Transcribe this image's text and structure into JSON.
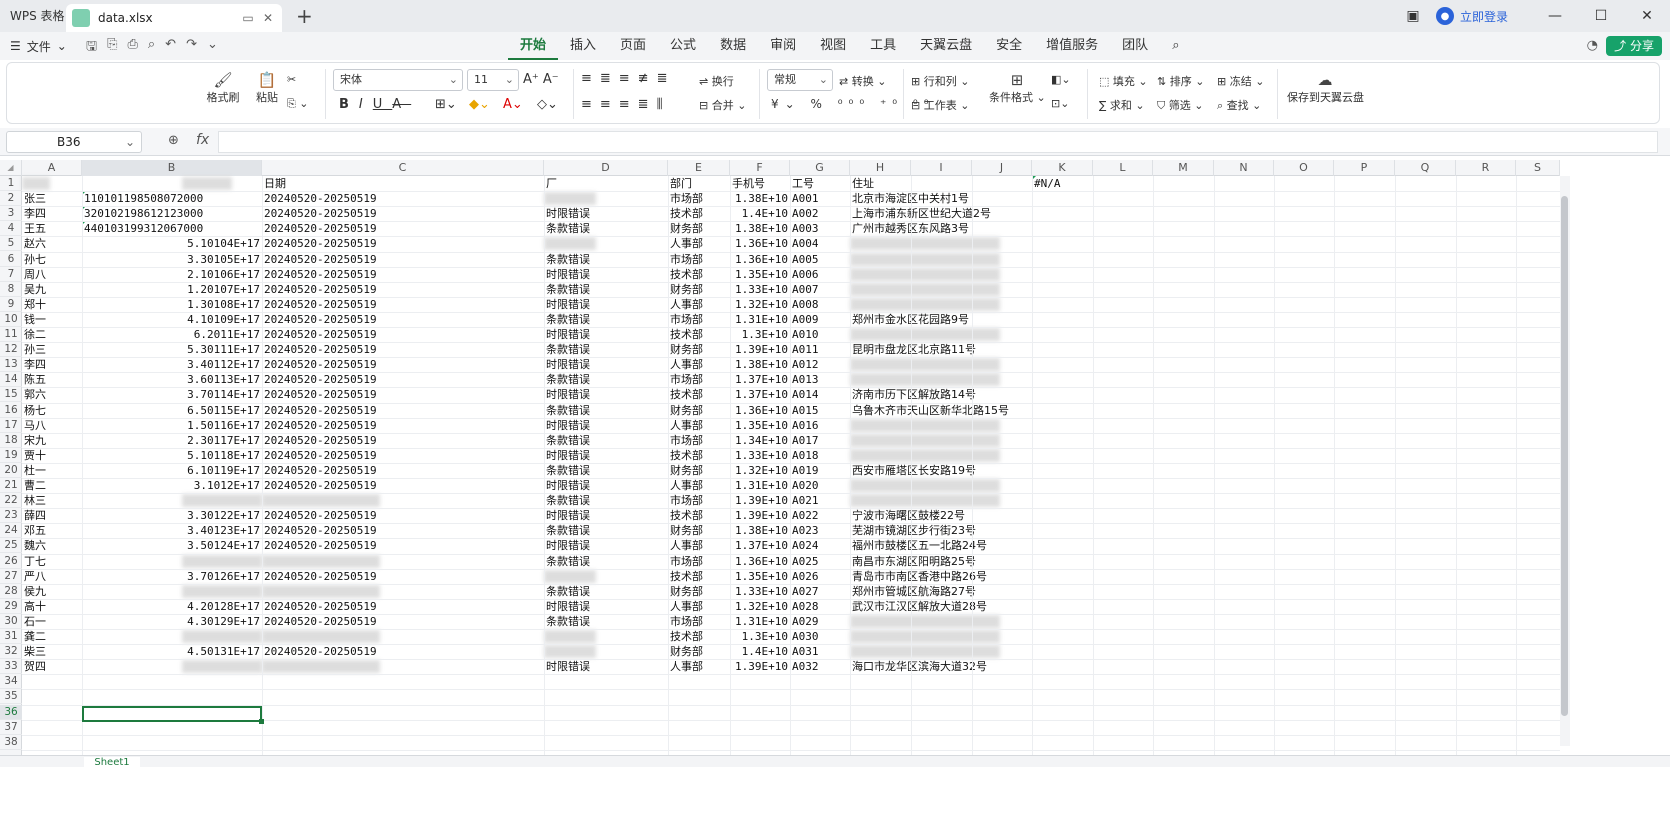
{
  "titlebar": {
    "app_tab": "WPS 表格",
    "file_tab": "data.xlsx",
    "login": "立即登录"
  },
  "menubar": {
    "file": "文件",
    "tabs": [
      "开始",
      "插入",
      "页面",
      "公式",
      "数据",
      "审阅",
      "视图",
      "工具",
      "天翼云盘",
      "安全",
      "增值服务",
      "团队"
    ],
    "share": "分享"
  },
  "ribbon": {
    "format_painter": "格式刷",
    "paste": "粘贴",
    "font_name": "宋体",
    "font_size": "11",
    "wrap": "换行",
    "merge": "合并",
    "number_format": "常规",
    "convert": "转换",
    "rows_cols": "行和列",
    "worksheet": "工作表",
    "cond_format": "条件格式",
    "fill": "填充",
    "sort": "排序",
    "freeze": "冻结",
    "sum": "求和",
    "filter": "筛选",
    "find": "查找",
    "save_cloud": "保存到天翼云盘"
  },
  "formula": {
    "cell_ref": "B36",
    "fx": "fx",
    "value": ""
  },
  "columns": [
    "A",
    "B",
    "C",
    "D",
    "E",
    "F",
    "G",
    "H",
    "I",
    "J",
    "K",
    "L",
    "M",
    "N",
    "O",
    "P",
    "Q",
    "R",
    "S"
  ],
  "rows_count": 38,
  "headers": {
    "C": "日期",
    "D": "厂",
    "E": "部门",
    "F": "手机号",
    "G": "工号",
    "H": "住址",
    "K": "#N/A"
  },
  "records": [
    {
      "a": "张三",
      "b": "110101198508072000",
      "c": "20240520-20250519",
      "d": "",
      "e": "市场部",
      "f": "1.38E+10",
      "g": "A001",
      "h": "北京市海淀区中关村1号"
    },
    {
      "a": "李四",
      "b": "320102198612123000",
      "c": "20240520-20250519",
      "d": "时限错误",
      "e": "技术部",
      "f": "1.4E+10",
      "g": "A002",
      "h": "上海市浦东新区世纪大道2号"
    },
    {
      "a": "王五",
      "b": "440103199312067000",
      "c": "20240520-20250519",
      "d": "条款错误",
      "e": "财务部",
      "f": "1.38E+10",
      "g": "A003",
      "h": "广州市越秀区东风路3号"
    },
    {
      "a": "赵六",
      "b": "5.10104E+17",
      "c": "20240520-20250519",
      "d": "",
      "e": "人事部",
      "f": "1.36E+10",
      "g": "A004",
      "h": ""
    },
    {
      "a": "孙七",
      "b": "3.30105E+17",
      "c": "20240520-20250519",
      "d": "条款错误",
      "e": "市场部",
      "f": "1.36E+10",
      "g": "A005",
      "h": ""
    },
    {
      "a": "周八",
      "b": "2.10106E+17",
      "c": "20240520-20250519",
      "d": "时限错误",
      "e": "技术部",
      "f": "1.35E+10",
      "g": "A006",
      "h": ""
    },
    {
      "a": "吴九",
      "b": "1.20107E+17",
      "c": "20240520-20250519",
      "d": "条款错误",
      "e": "财务部",
      "f": "1.33E+10",
      "g": "A007",
      "h": ""
    },
    {
      "a": "郑十",
      "b": "1.30108E+17",
      "c": "20240520-20250519",
      "d": "时限错误",
      "e": "人事部",
      "f": "1.32E+10",
      "g": "A008",
      "h": ""
    },
    {
      "a": "钱一",
      "b": "4.10109E+17",
      "c": "20240520-20250519",
      "d": "条款错误",
      "e": "市场部",
      "f": "1.31E+10",
      "g": "A009",
      "h": "郑州市金水区花园路9号"
    },
    {
      "a": "徐二",
      "b": "6.2011E+17",
      "c": "20240520-20250519",
      "d": "时限错误",
      "e": "技术部",
      "f": "1.3E+10",
      "g": "A010",
      "h": ""
    },
    {
      "a": "孙三",
      "b": "5.30111E+17",
      "c": "20240520-20250519",
      "d": "条款错误",
      "e": "财务部",
      "f": "1.39E+10",
      "g": "A011",
      "h": "昆明市盘龙区北京路11号"
    },
    {
      "a": "李四",
      "b": "3.40112E+17",
      "c": "20240520-20250519",
      "d": "时限错误",
      "e": "人事部",
      "f": "1.38E+10",
      "g": "A012",
      "h": ""
    },
    {
      "a": "陈五",
      "b": "3.60113E+17",
      "c": "20240520-20250519",
      "d": "条款错误",
      "e": "市场部",
      "f": "1.37E+10",
      "g": "A013",
      "h": ""
    },
    {
      "a": "郭六",
      "b": "3.70114E+17",
      "c": "20240520-20250519",
      "d": "时限错误",
      "e": "技术部",
      "f": "1.37E+10",
      "g": "A014",
      "h": "济南市历下区解放路14号"
    },
    {
      "a": "杨七",
      "b": "6.50115E+17",
      "c": "20240520-20250519",
      "d": "条款错误",
      "e": "财务部",
      "f": "1.36E+10",
      "g": "A015",
      "h": "乌鲁木齐市天山区新华北路15号"
    },
    {
      "a": "马八",
      "b": "1.50116E+17",
      "c": "20240520-20250519",
      "d": "时限错误",
      "e": "人事部",
      "f": "1.35E+10",
      "g": "A016",
      "h": ""
    },
    {
      "a": "宋九",
      "b": "2.30117E+17",
      "c": "20240520-20250519",
      "d": "条款错误",
      "e": "市场部",
      "f": "1.34E+10",
      "g": "A017",
      "h": ""
    },
    {
      "a": "贾十",
      "b": "5.10118E+17",
      "c": "20240520-20250519",
      "d": "时限错误",
      "e": "技术部",
      "f": "1.33E+10",
      "g": "A018",
      "h": ""
    },
    {
      "a": "杜一",
      "b": "6.10119E+17",
      "c": "20240520-20250519",
      "d": "条款错误",
      "e": "财务部",
      "f": "1.32E+10",
      "g": "A019",
      "h": "西安市雁塔区长安路19号"
    },
    {
      "a": "曹二",
      "b": "3.1012E+17",
      "c": "20240520-20250519",
      "d": "时限错误",
      "e": "人事部",
      "f": "1.31E+10",
      "g": "A020",
      "h": ""
    },
    {
      "a": "林三",
      "b": "",
      "c": "",
      "d": "条款错误",
      "e": "市场部",
      "f": "1.39E+10",
      "g": "A021",
      "h": ""
    },
    {
      "a": "薛四",
      "b": "3.30122E+17",
      "c": "20240520-20250519",
      "d": "时限错误",
      "e": "技术部",
      "f": "1.39E+10",
      "g": "A022",
      "h": "宁波市海曙区鼓楼22号"
    },
    {
      "a": "邓五",
      "b": "3.40123E+17",
      "c": "20240520-20250519",
      "d": "条款错误",
      "e": "财务部",
      "f": "1.38E+10",
      "g": "A023",
      "h": "芜湖市镜湖区步行街23号"
    },
    {
      "a": "魏六",
      "b": "3.50124E+17",
      "c": "20240520-20250519",
      "d": "时限错误",
      "e": "人事部",
      "f": "1.37E+10",
      "g": "A024",
      "h": "福州市鼓楼区五一北路24号"
    },
    {
      "a": "丁七",
      "b": "",
      "c": "",
      "d": "条款错误",
      "e": "市场部",
      "f": "1.36E+10",
      "g": "A025",
      "h": "南昌市东湖区阳明路25号"
    },
    {
      "a": "严八",
      "b": "3.70126E+17",
      "c": "20240520-20250519",
      "d": "",
      "e": "技术部",
      "f": "1.35E+10",
      "g": "A026",
      "h": "青岛市市南区香港中路26号"
    },
    {
      "a": "侯九",
      "b": "",
      "c": "",
      "d": "条款错误",
      "e": "财务部",
      "f": "1.33E+10",
      "g": "A027",
      "h": "郑州市管城区航海路27号"
    },
    {
      "a": "高十",
      "b": "4.20128E+17",
      "c": "20240520-20250519",
      "d": "时限错误",
      "e": "人事部",
      "f": "1.32E+10",
      "g": "A028",
      "h": "武汉市江汉区解放大道28号"
    },
    {
      "a": "石一",
      "b": "4.30129E+17",
      "c": "20240520-20250519",
      "d": "条款错误",
      "e": "市场部",
      "f": "1.31E+10",
      "g": "A029",
      "h": ""
    },
    {
      "a": "龚二",
      "b": "",
      "c": "",
      "d": "",
      "e": "技术部",
      "f": "1.3E+10",
      "g": "A030",
      "h": ""
    },
    {
      "a": "柴三",
      "b": "4.50131E+17",
      "c": "20240520-20250519",
      "d": "",
      "e": "财务部",
      "f": "1.4E+10",
      "g": "A031",
      "h": ""
    },
    {
      "a": "贺四",
      "b": "",
      "c": "",
      "d": "时限错误",
      "e": "人事部",
      "f": "1.39E+10",
      "g": "A032",
      "h": "海口市龙华区滨海大道32号"
    }
  ],
  "sheet": {
    "tab": "Sheet1"
  }
}
